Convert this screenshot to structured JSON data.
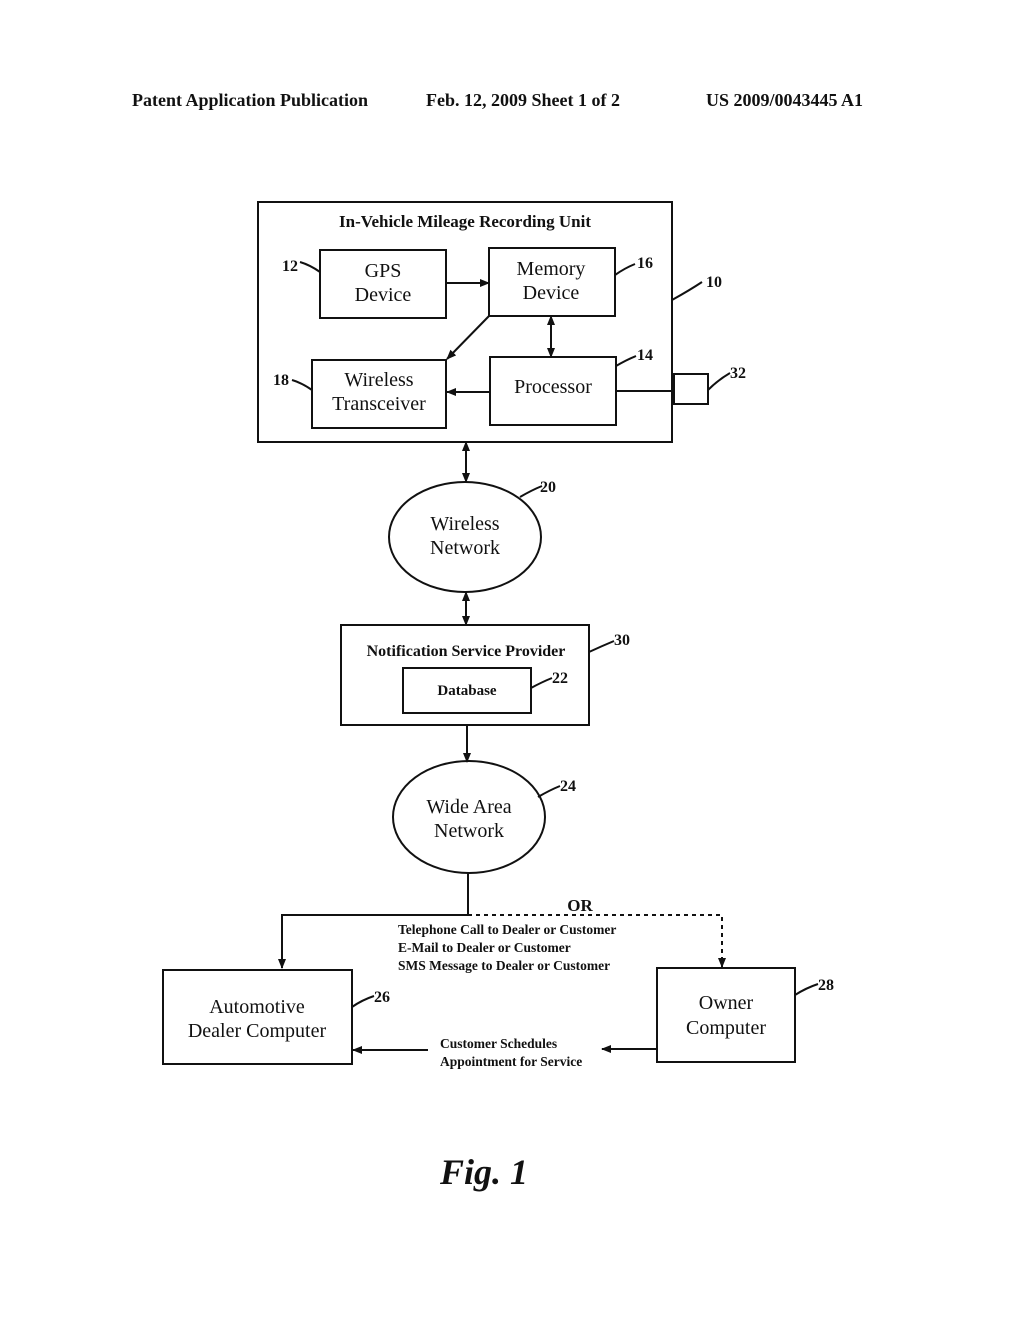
{
  "header": {
    "left": "Patent Application Publication",
    "middle": "Feb. 12, 2009  Sheet 1 of 2",
    "right": "US 2009/0043445 A1"
  },
  "diagram": {
    "unit": {
      "title": "In-Vehicle Mileage Recording Unit",
      "ref": "10"
    },
    "gps": {
      "line1": "GPS",
      "line2": "Device",
      "ref": "12"
    },
    "memory": {
      "line1": "Memory",
      "line2": "Device",
      "ref": "16"
    },
    "transceiver": {
      "line1": "Wireless",
      "line2": "Transceiver",
      "ref": "18"
    },
    "processor": {
      "label": "Processor",
      "ref": "14"
    },
    "port": {
      "ref": "32"
    },
    "wireless_network": {
      "line1": "Wireless",
      "line2": "Network",
      "ref": "20"
    },
    "nsp": {
      "title": "Notification Service Provider",
      "ref": "30"
    },
    "database": {
      "label": "Database",
      "ref": "22"
    },
    "wan": {
      "line1": "Wide Area",
      "line2": "Network",
      "ref": "24"
    },
    "or_label": "OR",
    "notifications": [
      "Telephone Call to Dealer or Customer",
      "E-Mail to Dealer or Customer",
      "SMS Message to Dealer or Customer"
    ],
    "dealer": {
      "line1": "Automotive",
      "line2": "Dealer Computer",
      "ref": "26"
    },
    "owner": {
      "line1": "Owner",
      "line2": "Computer",
      "ref": "28"
    },
    "schedule": {
      "line1": "Customer Schedules",
      "line2": "Appointment for Service"
    }
  },
  "figure_label": "Fig. 1"
}
